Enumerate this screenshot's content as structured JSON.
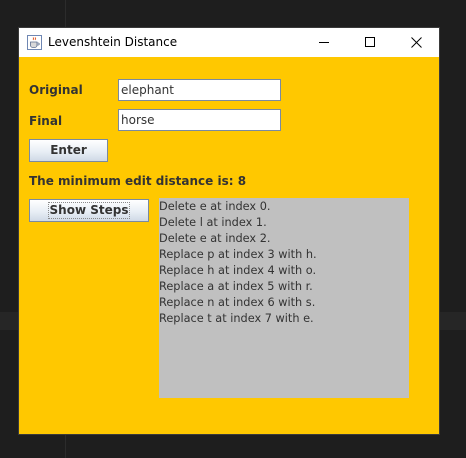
{
  "window": {
    "title": "Levenshtein Distance",
    "icon": "java-cup-icon"
  },
  "form": {
    "original_label": "Original",
    "original_value": "elephant",
    "final_label": "Final",
    "final_value": "horse",
    "enter_label": "Enter",
    "result_text": "The minimum edit distance is: 8",
    "show_steps_label": "Show Steps"
  },
  "steps": [
    "Delete e at index 0.",
    "Delete l at index 1.",
    "Delete e at index 2.",
    "Replace p at index 3 with h.",
    "Replace h at index 4 with o.",
    "Replace a at index 5 with r.",
    "Replace n at index 6 with s.",
    "Replace t at index 7 with e."
  ],
  "colors": {
    "window_background": "#ffc800",
    "steps_background": "#c0c0c0"
  }
}
